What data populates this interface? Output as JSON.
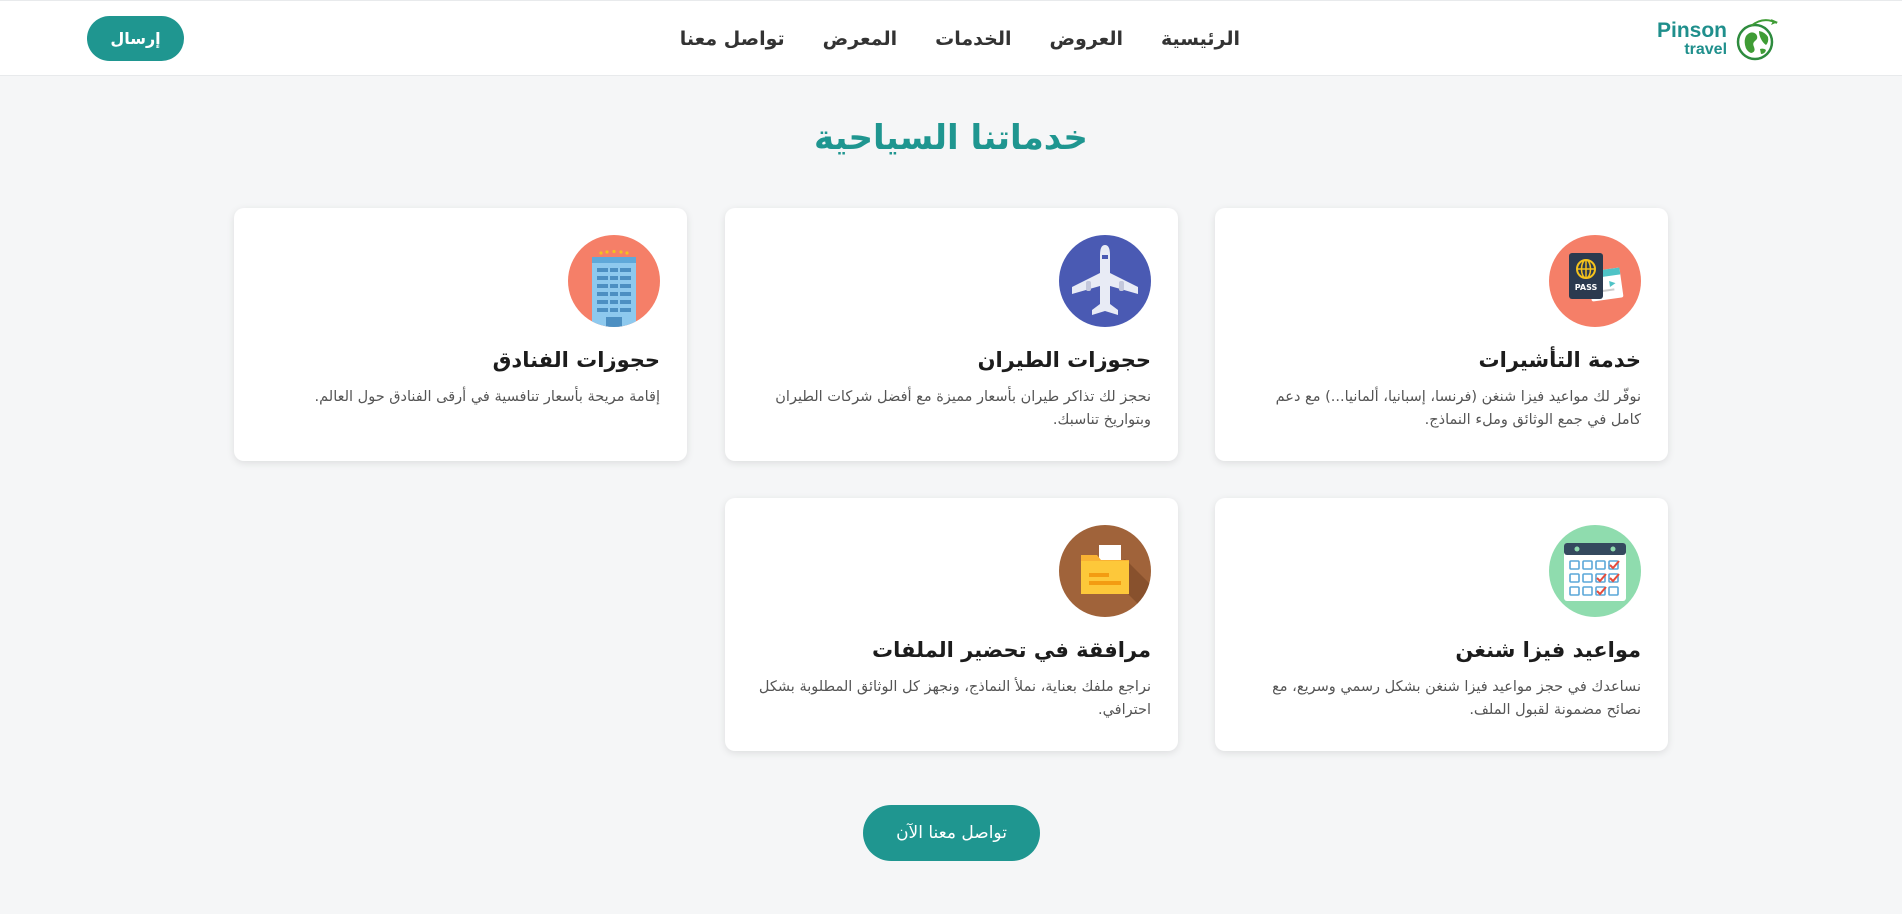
{
  "brand": {
    "name_line1": "Pinson",
    "name_line2": "travel"
  },
  "nav": {
    "items": [
      {
        "label": "الرئيسية"
      },
      {
        "label": "العروض"
      },
      {
        "label": "الخدمات"
      },
      {
        "label": "المعرض"
      },
      {
        "label": "تواصل معنا"
      }
    ],
    "send_label": "إرسال"
  },
  "services": {
    "title": "خدماتنا السياحية",
    "cards": [
      {
        "icon": "passport-icon",
        "title": "خدمة التأشيرات",
        "description": "نوفّر لك مواعيد فيزا شنغن (فرنسا، إسبانيا، ألمانيا...) مع دعم كامل في جمع الوثائق وملء النماذج.",
        "icon_bg": "#f57f68"
      },
      {
        "icon": "airplane-icon",
        "title": "حجوزات الطيران",
        "description": "نحجز لك تذاكر طيران بأسعار مميزة مع أفضل شركات الطيران وبتواريخ تناسبك.",
        "icon_bg": "#4a5ab3"
      },
      {
        "icon": "hotel-icon",
        "title": "حجوزات الفنادق",
        "description": "إقامة مريحة بأسعار تنافسية في أرقى الفنادق حول العالم.",
        "icon_bg": "#f57f68"
      },
      {
        "icon": "calendar-icon",
        "title": "مواعيد فيزا شنغن",
        "description": "نساعدك في حجز مواعيد فيزا شنغن بشكل رسمي وسريع، مع نصائح مضمونة لقبول الملف.",
        "icon_bg": "#8fdcae"
      },
      {
        "icon": "folder-icon",
        "title": "مرافقة في تحضير الملفات",
        "description": "نراجع ملفك بعناية، نملأ النماذج، ونجهز كل الوثائق المطلوبة بشكل احترافي.",
        "icon_bg": "#a0633a"
      }
    ]
  },
  "cta": {
    "label": "تواصل معنا الآن"
  },
  "colors": {
    "accent": "#1f9690",
    "background": "#f5f6f7"
  }
}
